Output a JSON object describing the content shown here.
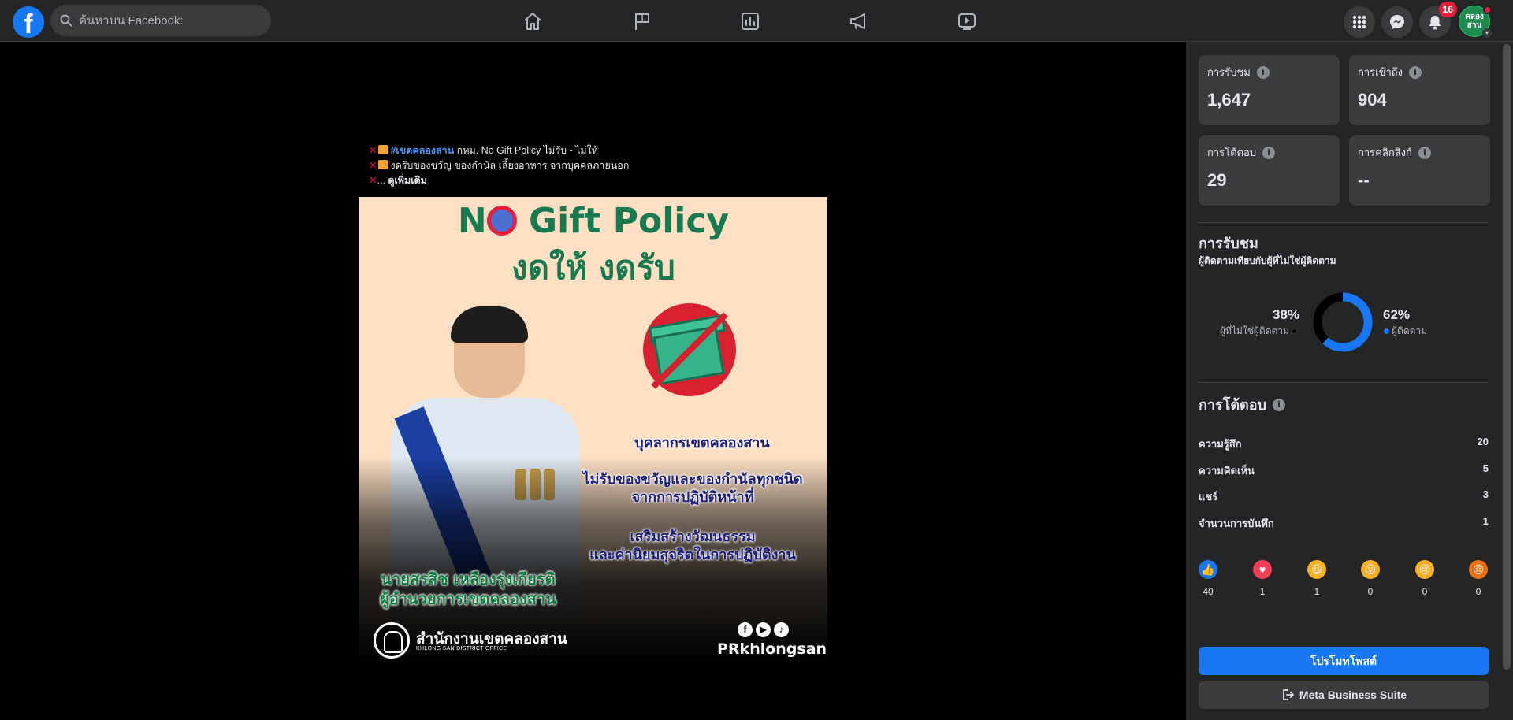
{
  "topbar": {
    "logo": "f",
    "search_placeholder": "ค้นหาบน Facebook:",
    "nav_icons": [
      "home-icon",
      "flag-icon",
      "insights-icon",
      "megaphone-icon",
      "video-icon"
    ],
    "right_icons": [
      "menu-grid-icon",
      "messenger-icon",
      "bell-icon"
    ],
    "notification_count": "16",
    "profile_label": "คลอง สาน"
  },
  "post": {
    "caption_line1_hashtag": "#เขตคลองสาน",
    "caption_line1_text": " กทม. No Gift Policy ไม่รับ - ไม่ให้",
    "caption_line2": "งดรับของขวัญ ของกำนัล เลี้ยงอาหาร จากบุคคลภายนอก",
    "caption_line3_prefix": "...",
    "see_more": "ดูเพิ่มเติม",
    "image": {
      "title_a": "N",
      "title_b": " Gift Policy",
      "subtitle": "งดให้ งดรับ",
      "line1": "บุคลากรเขตคลองสาน",
      "line2": "ไม่รับของขวัญและของกำนัลทุกชนิด",
      "line3": "จากการปฏิบัติหน้าที่",
      "line4": "เสริมสร้างวัฒนธรรม",
      "line5": "และค่านิยมสุจริตในการปฏิบัติงาน",
      "name": "นายสรสิช เหลืองรุ่งเกียรติ",
      "position": "ผู้อำนวยการเขตคลองสาน",
      "office_th": "สำนักงานเขตคลองสาน",
      "office_en": "KHLONG SAN DISTRICT OFFICE",
      "handle": "PRkhlongsan"
    }
  },
  "insights": {
    "stats": [
      {
        "label": "การรับชม",
        "value": "1,647"
      },
      {
        "label": "การเข้าถึง",
        "value": "904"
      },
      {
        "label": "การโต้ตอบ",
        "value": "29"
      },
      {
        "label": "การคลิกลิงก์",
        "value": "--"
      }
    ],
    "views_title": "การรับชม",
    "views_subtitle": "ผู้ติดตามเทียบกับผู้ที่ไม่ใช่ผู้ติดตาม",
    "non_followers_pct": "38%",
    "non_followers_label": "ผู้ที่ไม่ใช่ผู้ติดตาม",
    "followers_pct": "62%",
    "followers_label": "ผู้ติดตาม",
    "followers_fraction": 0.62,
    "colors": {
      "followers": "#1877f2",
      "non_followers": "#000000"
    },
    "engagement_title": "การโต้ตอบ",
    "engagement_rows": [
      {
        "label": "ความรู้สึก",
        "value": "20"
      },
      {
        "label": "ความคิดเห็น",
        "value": "5"
      },
      {
        "label": "แชร์",
        "value": "3"
      },
      {
        "label": "จำนวนการบันทึก",
        "value": "1"
      }
    ],
    "reactions": [
      {
        "icon": "like-icon",
        "count": "40"
      },
      {
        "icon": "love-icon",
        "count": "1"
      },
      {
        "icon": "haha-icon",
        "count": "1"
      },
      {
        "icon": "wow-icon",
        "count": "0"
      },
      {
        "icon": "sad-icon",
        "count": "0"
      },
      {
        "icon": "angry-icon",
        "count": "0"
      }
    ],
    "promote_label": "โปรโมทโพสต์",
    "meta_label": "Meta Business Suite"
  }
}
